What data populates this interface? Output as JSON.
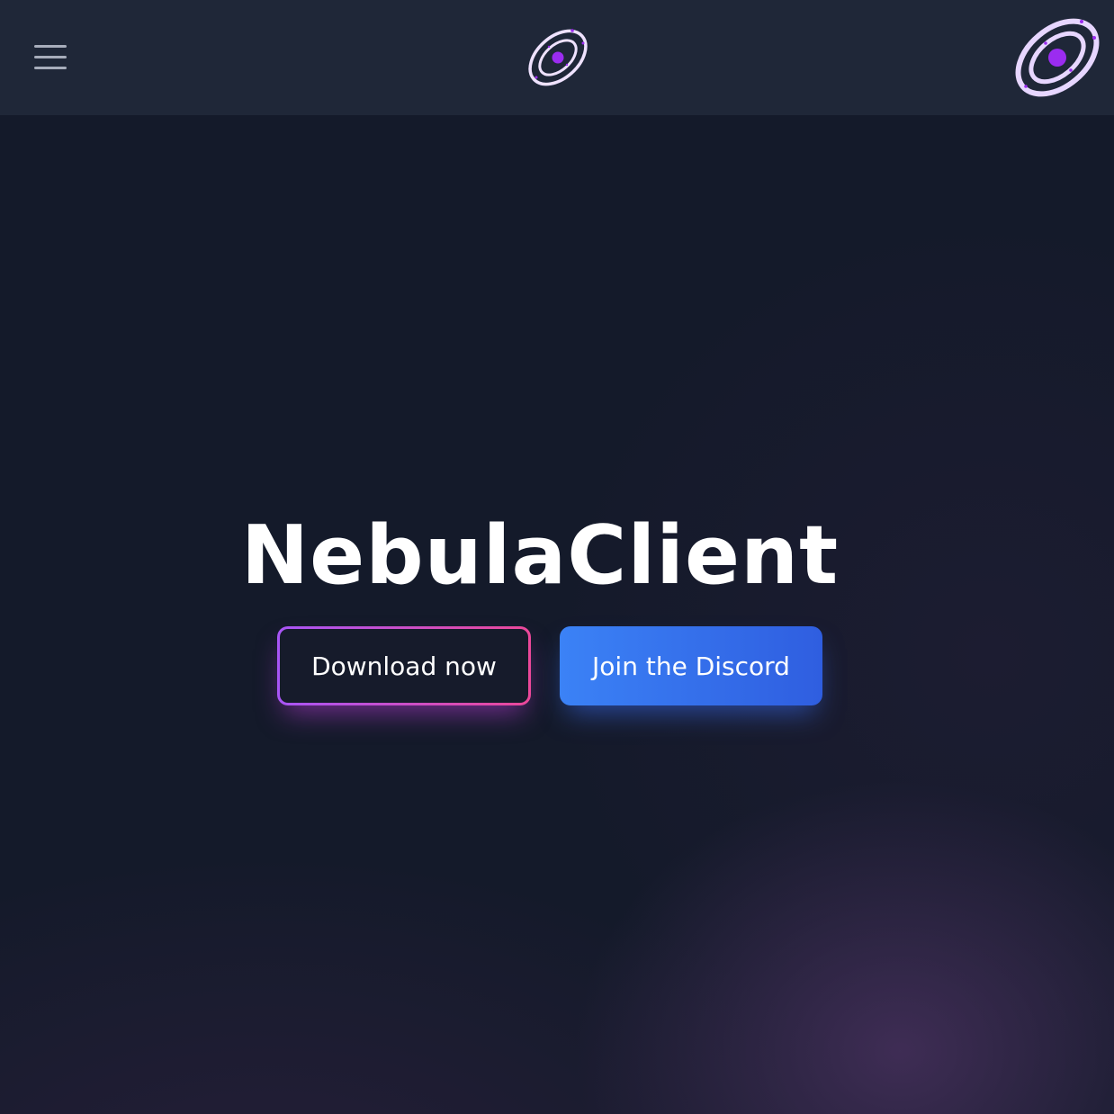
{
  "navbar": {
    "menu_icon": "hamburger-menu-icon",
    "logo_icon": "nebula-orbit-logo-icon",
    "corner_logo_icon": "nebula-orbit-logo-icon"
  },
  "hero": {
    "title": "NebulaClient",
    "download_label": "Download now",
    "discord_label": "Join the Discord"
  },
  "colors": {
    "background": "#141a2a",
    "navbar": "#1f2738",
    "download_border_start": "#a855f7",
    "download_border_end": "#ec4899",
    "discord_start": "#3b82f6",
    "discord_end": "#2f5ee0",
    "logo_accent": "#9b2cf0"
  }
}
